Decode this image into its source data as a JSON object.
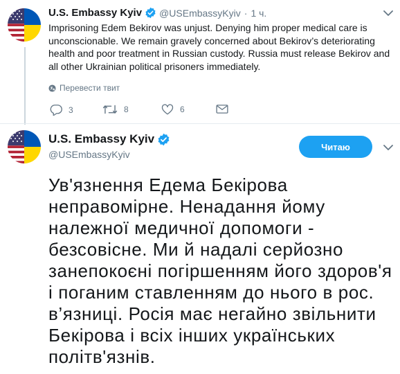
{
  "colors": {
    "accent": "#1da1f2",
    "muted": "#657786",
    "text": "#14171a"
  },
  "tweet_top": {
    "name": "U.S. Embassy Kyiv",
    "handle": "@USEmbassyKyiv",
    "dot": "·",
    "time": "1 ч.",
    "text": "Imprisoning Edem Bekirov was unjust. Denying him proper medical care is unconscionable. We remain gravely concerned about Bekirov’s deteriorating health and poor treatment in Russian custody. Russia must release Bekirov and all other Ukrainian political prisoners immediately.",
    "translate_label": "Перевести твит",
    "replies": "3",
    "retweets": "8",
    "likes": "6",
    "icons": [
      "verified-icon",
      "chevron-down-icon",
      "globe-icon",
      "reply-icon",
      "retweet-icon",
      "heart-icon",
      "envelope-icon"
    ]
  },
  "tweet_main": {
    "name": "U.S. Embassy Kyiv",
    "handle": "@USEmbassyKyiv",
    "follow_label": "Читаю",
    "text": "Ув'язнення Едема Бекірова неправомірне. Ненадання йому належної медичної допомоги - безсовісне. Ми й надалі серйозно занепокоєні погіршенням його здоров'я і поганим ставленням до нього в рос. в’язниці. Росія має негайно звільнити Бекірова і всіх інших українських політв'язнів."
  }
}
